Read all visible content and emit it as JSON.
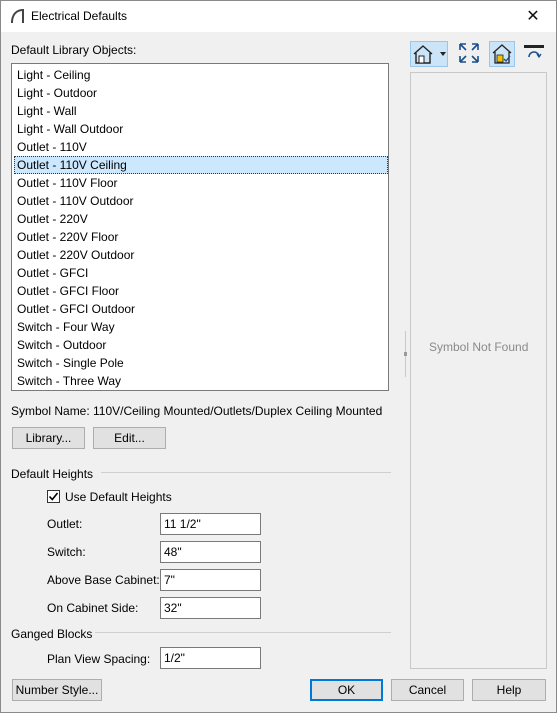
{
  "window": {
    "title": "Electrical Defaults",
    "close_glyph": "✕",
    "app_icon": "chief-architect-arc-icon"
  },
  "library": {
    "label": "Default Library Objects:",
    "items": [
      "Light - Ceiling",
      "Light - Outdoor",
      "Light - Wall",
      "Light - Wall Outdoor",
      "Outlet - 110V",
      "Outlet - 110V Ceiling",
      "Outlet - 110V Floor",
      "Outlet - 110V Outdoor",
      "Outlet - 220V",
      "Outlet - 220V Floor",
      "Outlet - 220V Outdoor",
      "Outlet - GFCI",
      "Outlet - GFCI Floor",
      "Outlet - GFCI Outdoor",
      "Switch - Four Way",
      "Switch - Outdoor",
      "Switch - Single Pole",
      "Switch - Three Way"
    ],
    "selected_index": 5
  },
  "symbol": {
    "label": "Symbol Name:",
    "value": "110V/Ceiling Mounted/Outlets/Duplex Ceiling Mounted"
  },
  "buttons": {
    "library": "Library...",
    "edit": "Edit...",
    "number_style": "Number Style...",
    "ok": "OK",
    "cancel": "Cancel",
    "help": "Help"
  },
  "heights": {
    "group_label": "Default Heights",
    "use_default_label": "Use Default Heights",
    "use_default_checked": true,
    "check_glyph": "✓",
    "outlet_label": "Outlet:",
    "outlet_value": "11 1/2\"",
    "switch_label": "Switch:",
    "switch_value": "48\"",
    "above_base_label": "Above Base Cabinet:",
    "above_base_value": "7\"",
    "cabinet_side_label": "On Cabinet Side:",
    "cabinet_side_value": "32\""
  },
  "ganged": {
    "group_label": "Ganged Blocks",
    "spacing_label": "Plan View Spacing:",
    "spacing_value": "1/2\""
  },
  "preview": {
    "message": "Symbol Not Found",
    "toolbar_icons": [
      "view-mode-dropdown-icon",
      "fill-window-icon",
      "plan-symbol-toggle-icon",
      "lock-preview-icon"
    ]
  },
  "colors": {
    "selection": "#cce8ff",
    "default_button_border": "#0078d7",
    "toolbar_pressed": "#cce4f7"
  }
}
